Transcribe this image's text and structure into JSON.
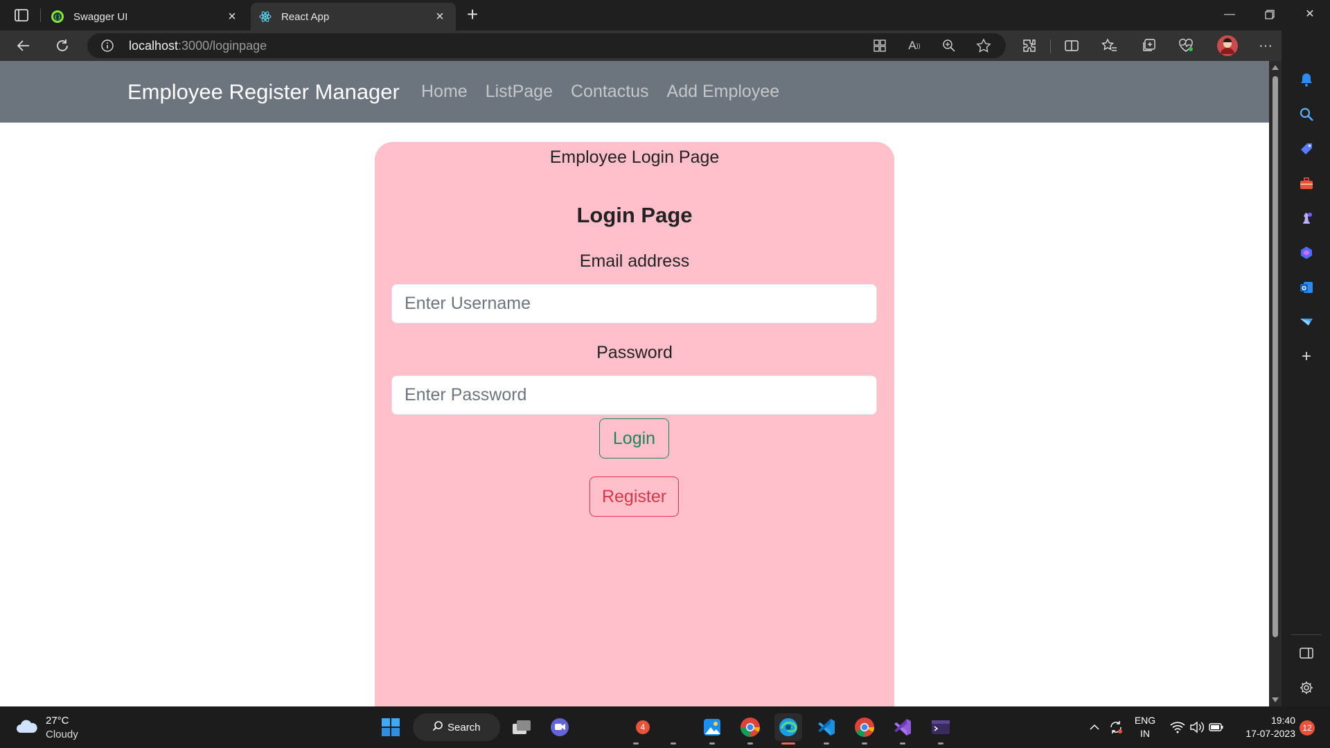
{
  "browser": {
    "tabs": [
      {
        "title": "Swagger UI",
        "active": false
      },
      {
        "title": "React App",
        "active": true
      }
    ],
    "address": {
      "host": "localhost",
      "path": ":3000/loginpage"
    }
  },
  "app": {
    "brand": "Employee Register Manager",
    "nav": [
      "Home",
      "ListPage",
      "Contactus",
      "Add Employee"
    ]
  },
  "login": {
    "subtitle": "Employee Login Page",
    "heading": "Login Page",
    "email_label": "Email address",
    "email_placeholder": "Enter Username",
    "password_label": "Password",
    "password_placeholder": "Enter Password",
    "login_button": "Login",
    "register_button": "Register",
    "card_color": "#ffc0cb",
    "login_color": "#198754",
    "register_color": "#dc3545"
  },
  "taskbar": {
    "weather_temp": "27°C",
    "weather_desc": "Cloudy",
    "search_label": "Search",
    "teams_badge": "4",
    "lang_top": "ENG",
    "lang_bottom": "IN",
    "time": "19:40",
    "date": "17-07-2023",
    "notification_count": "12"
  }
}
